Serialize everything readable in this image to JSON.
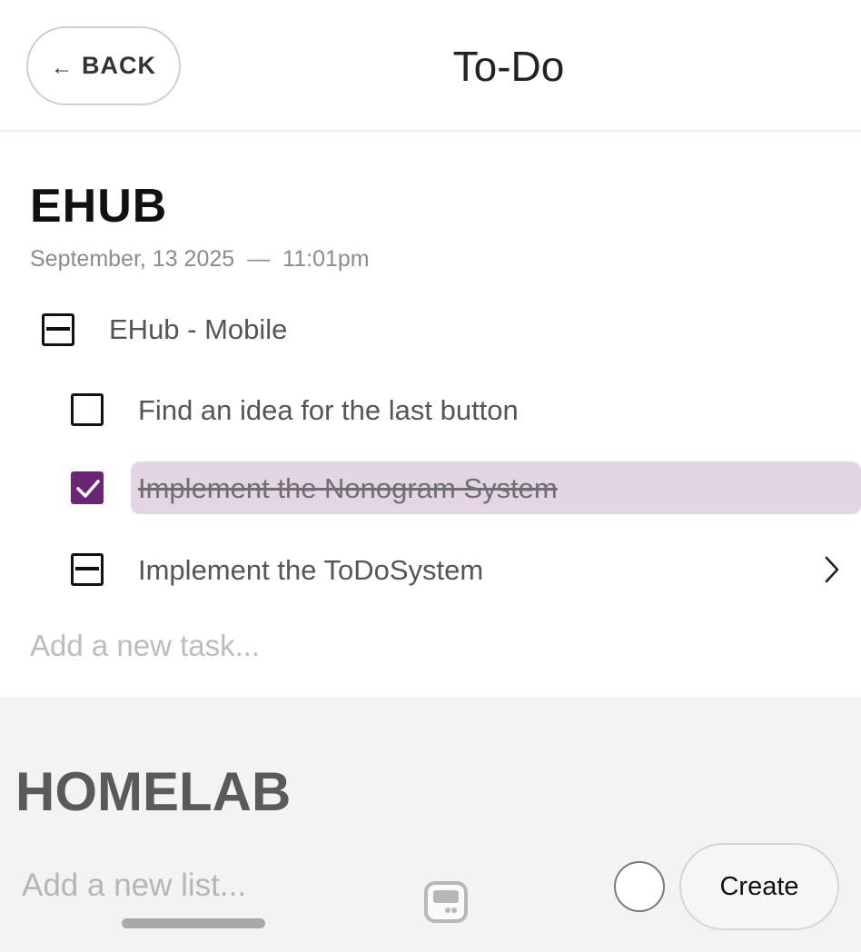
{
  "header": {
    "back_arrow": "←",
    "back_label": "BACK",
    "title": "To-Do"
  },
  "list": {
    "title": "EHUB",
    "date": "September, 13 2025",
    "separator": "—",
    "time": "11:01pm",
    "group": {
      "label": "EHub - Mobile",
      "state": "partial"
    },
    "tasks": [
      {
        "label": "Find an idea for the last button",
        "state": "unchecked"
      },
      {
        "label": "Implement the Nonogram System",
        "state": "checked"
      },
      {
        "label": "Implement the ToDoSystem",
        "state": "partial",
        "icon": "chevron-right-icon"
      }
    ],
    "add_task_placeholder": "Add a new task..."
  },
  "second_list": {
    "title": "HOMELAB"
  },
  "footer": {
    "new_list_placeholder": "Add a new list...",
    "create_label": "Create",
    "middle_icon": "keyboard-toggle-icon"
  },
  "colors": {
    "accent": "#6a2675",
    "highlight": "#e3d5e4",
    "bottom_bg": "#f3f3f3"
  }
}
